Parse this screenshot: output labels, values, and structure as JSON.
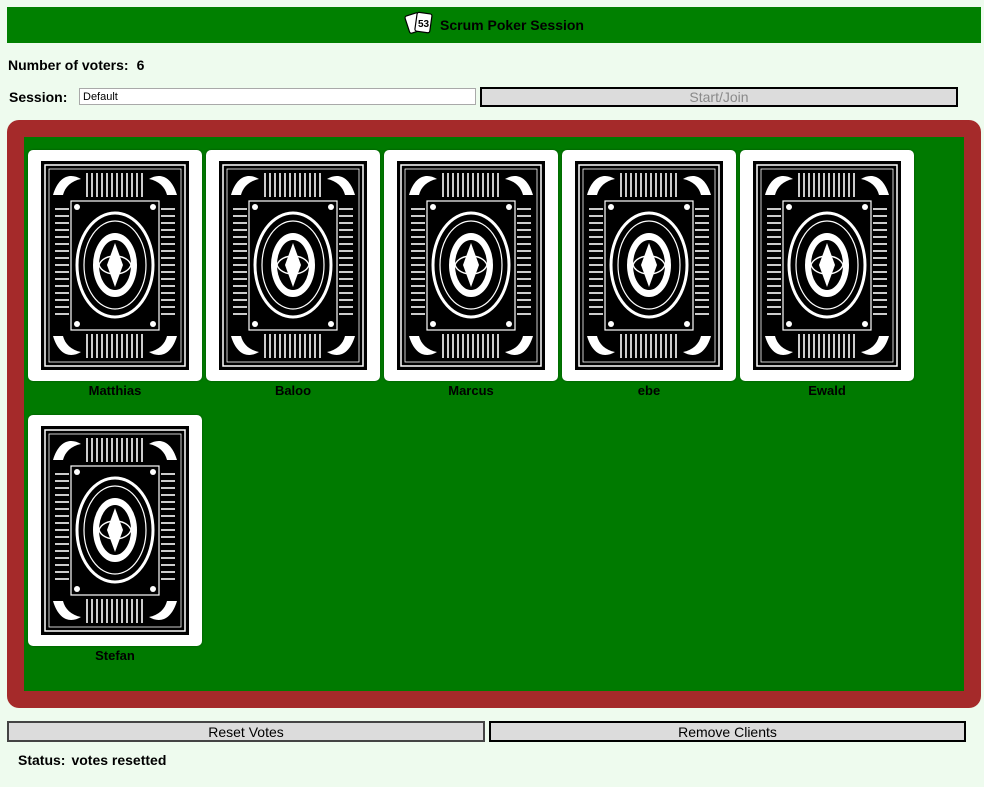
{
  "header": {
    "title": "Scrum Poker Session",
    "logo_icon": "playing-cards-icon",
    "logo_text": "53"
  },
  "voters": {
    "label": "Number of voters:",
    "count": "6"
  },
  "session": {
    "label": "Session:",
    "value": "Default",
    "start_label": "Start/Join",
    "start_disabled": true
  },
  "table": {
    "felt_color": "#007a00",
    "border_color": "#a52a2a",
    "cards": [
      {
        "name": "Matthias",
        "face_down": true
      },
      {
        "name": "Baloo",
        "face_down": true
      },
      {
        "name": "Marcus",
        "face_down": true
      },
      {
        "name": "ebe",
        "face_down": true
      },
      {
        "name": "Ewald",
        "face_down": true
      },
      {
        "name": "Stefan",
        "face_down": true
      }
    ]
  },
  "actions": {
    "reset_label": "Reset Votes",
    "remove_label": "Remove Clients"
  },
  "status": {
    "label": "Status:",
    "value": "votes resetted"
  }
}
